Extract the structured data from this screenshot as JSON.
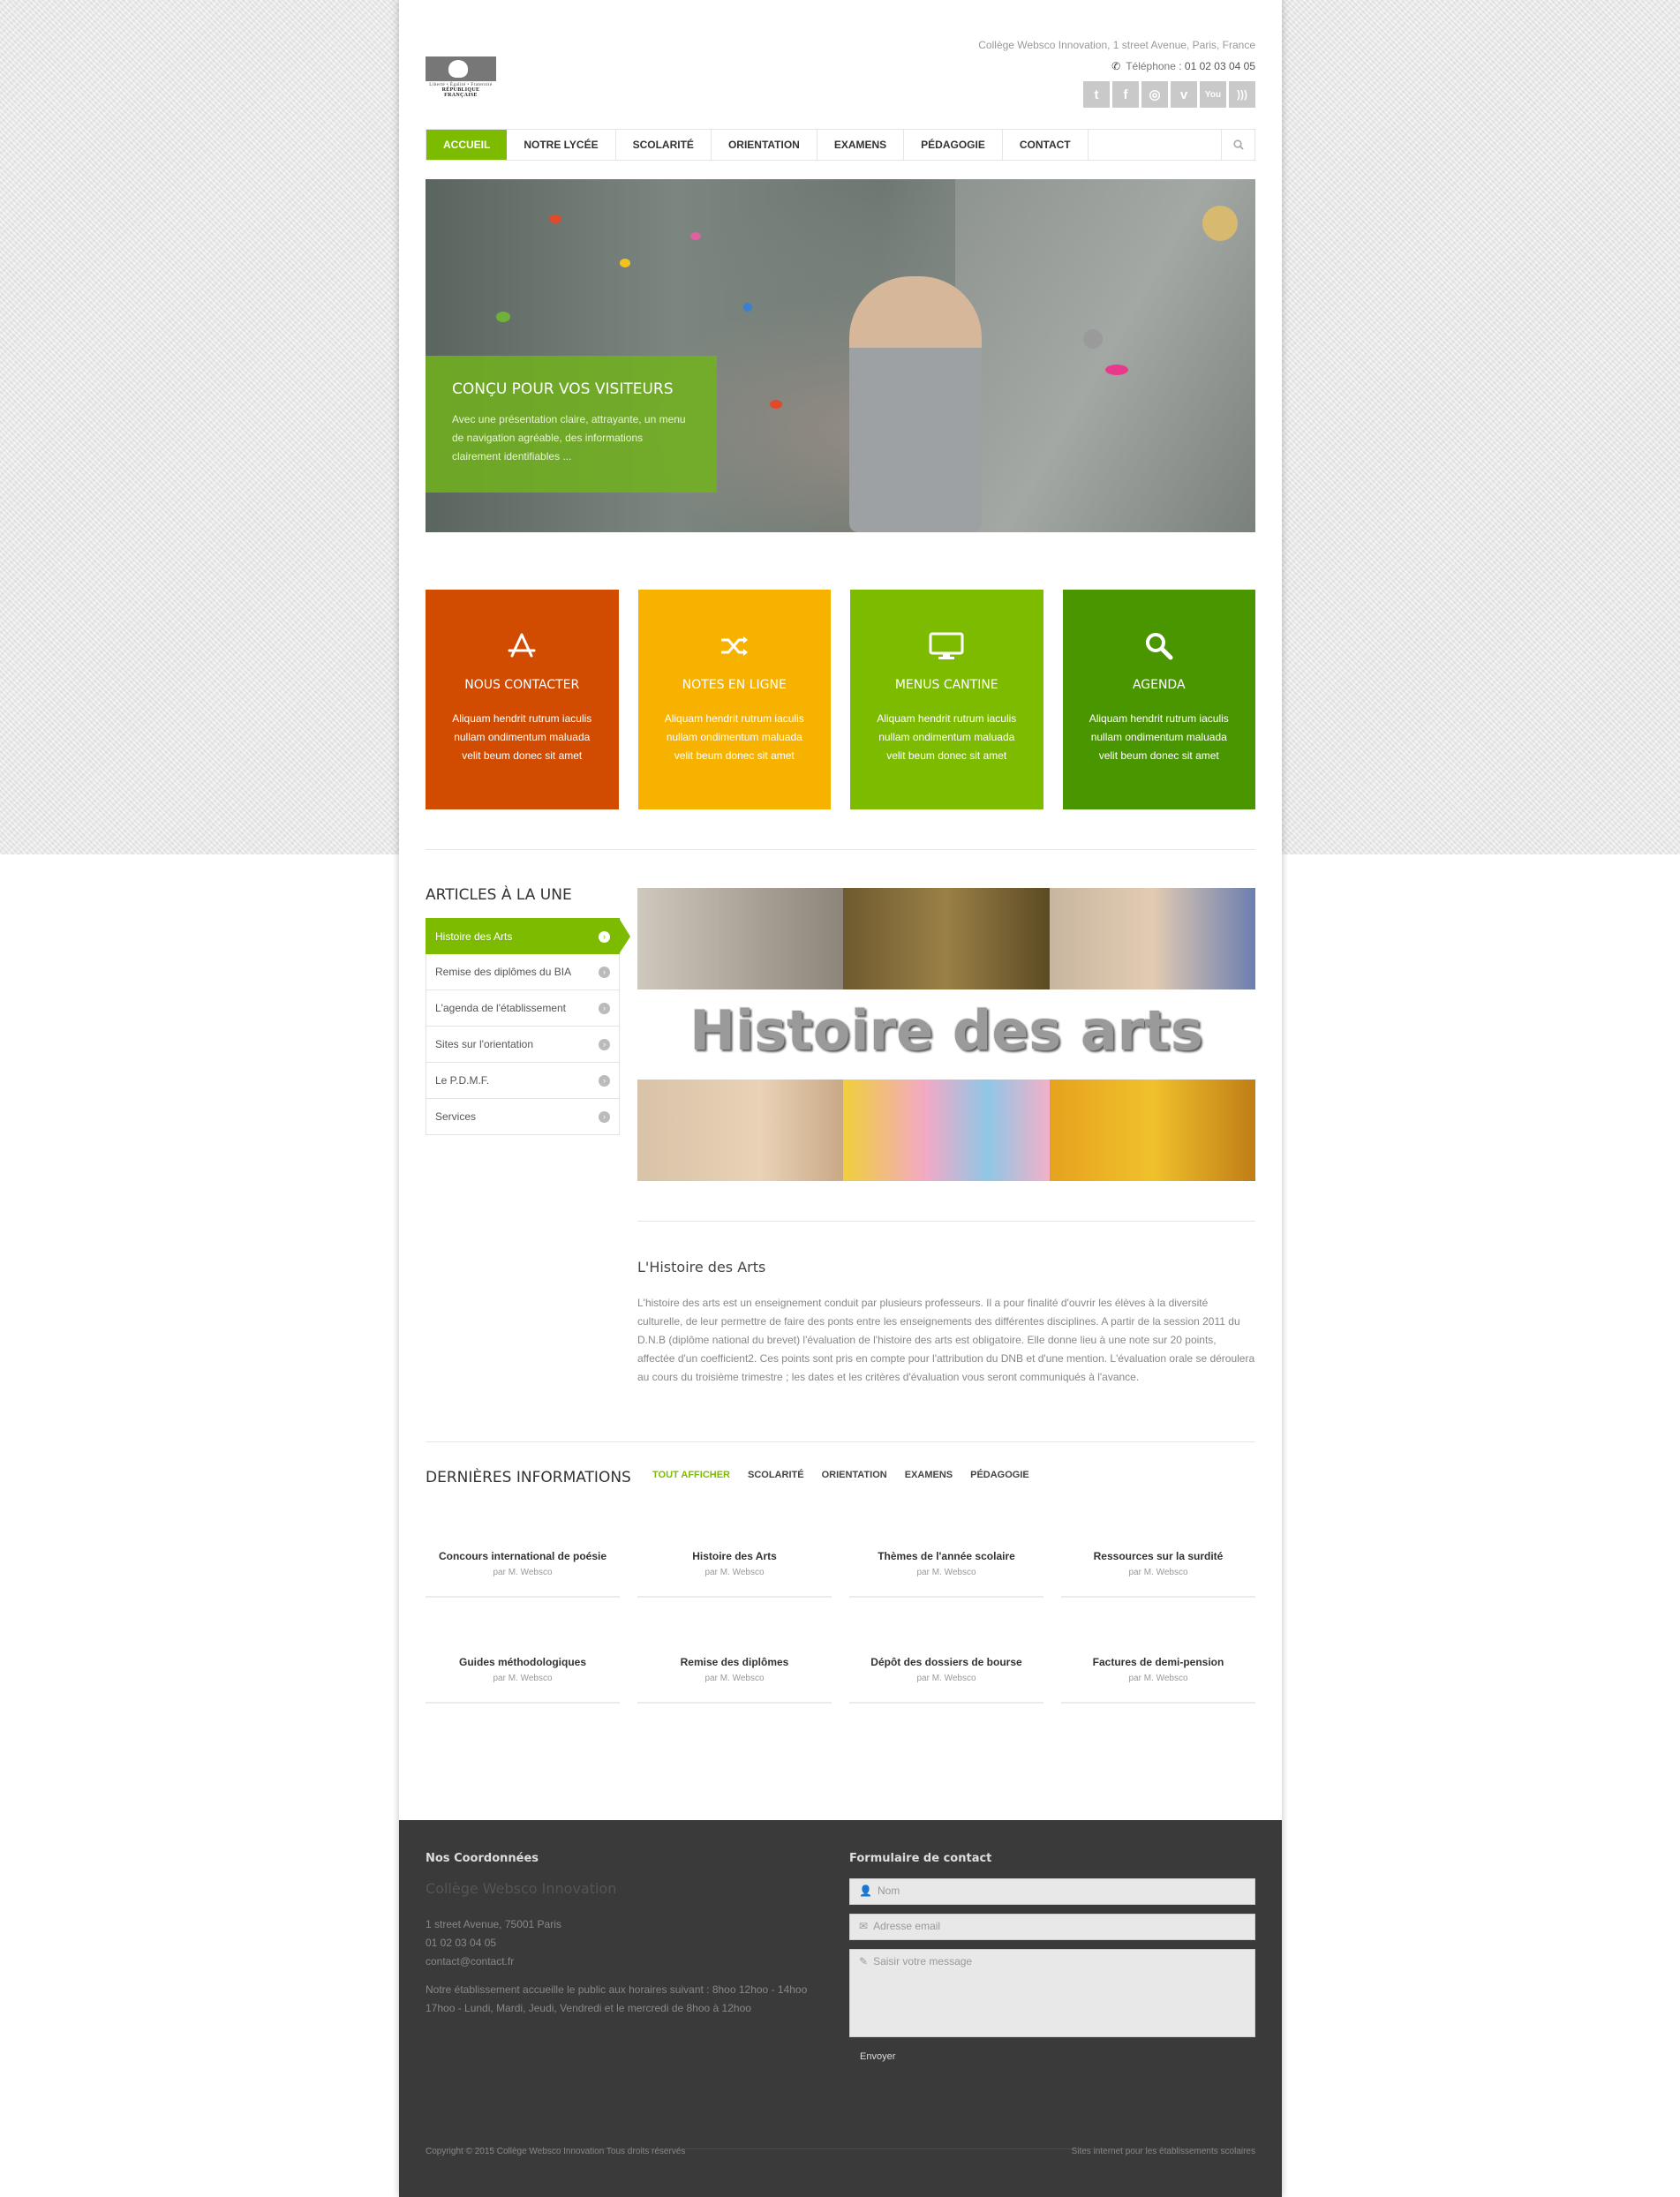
{
  "header": {
    "logo_motto": "Liberté • Égalité • Fraternité",
    "logo_rep": "RÉPUBLIQUE FRANÇAISE",
    "address": "Collège Websco Innovation, 1 street Avenue, Paris, France",
    "phone_label": "Téléphone :",
    "phone_number": "01 02 03 04 05",
    "social": [
      "twitter-icon",
      "facebook-icon",
      "dribbble-icon",
      "vimeo-icon",
      "youtube-icon",
      "rss-icon"
    ]
  },
  "nav": {
    "items": [
      "ACCUEIL",
      "NOTRE LYCÉE",
      "SCOLARITÉ",
      "ORIENTATION",
      "EXAMENS",
      "PÉDAGOGIE",
      "CONTACT"
    ],
    "active": "ACCUEIL"
  },
  "hero": {
    "title": "CONÇU POUR VOS VISITEURS",
    "text": "Avec une présentation claire, attrayante, un menu de navigation agréable, des informations clairement identifiables ..."
  },
  "boxes": [
    {
      "title": "NOUS CONTACTER",
      "text": "Aliquam hendrit rutrum iaculis nullam ondimentum maluada velit beum donec sit amet",
      "color": "#d14b00"
    },
    {
      "title": "NOTES EN LIGNE",
      "text": "Aliquam hendrit rutrum iaculis nullam ondimentum maluada velit beum donec sit amet",
      "color": "#f7b200"
    },
    {
      "title": "MENUS CANTINE",
      "text": "Aliquam hendrit rutrum iaculis nullam ondimentum maluada velit beum donec sit amet",
      "color": "#7dbb00"
    },
    {
      "title": "AGENDA",
      "text": "Aliquam hendrit rutrum iaculis nullam ondimentum maluada velit beum donec sit amet",
      "color": "#4a9600"
    }
  ],
  "articles": {
    "title": "ARTICLES À LA UNE",
    "tabs": [
      "Histoire des Arts",
      "Remise des diplômes du BIA",
      "L'agenda de l'établissement",
      "Sites sur l'orientation",
      "Le P.D.M.F.",
      "Services"
    ],
    "banner_title": "Histoire des arts",
    "article_title": "L'Histoire des Arts",
    "article_text": "L'histoire des arts est un enseignement conduit par plusieurs professeurs. Il a pour finalité d'ouvrir les élèves à la diversité culturelle, de leur permettre de faire des ponts entre les enseignements des différentes disciplines. A partir de la session 2011 du D.N.B (diplôme national du brevet) l'évaluation de l'histoire des arts est obligatoire. Elle donne lieu à une note sur 20 points, affectée d'un coefficient2. Ces points sont pris en compte pour l'attribution du DNB et d'une mention. L'évaluation orale se déroulera au cours du troisième trimestre ; les dates et les critères d'évaluation vous seront communiqués à l'avance."
  },
  "latest": {
    "title": "DERNIÈRES INFORMATIONS",
    "filters": [
      "TOUT AFFICHER",
      "SCOLARITÉ",
      "ORIENTATION",
      "EXAMENS",
      "PÉDAGOGIE"
    ],
    "cards": [
      {
        "title": "Concours international de poésie",
        "author": "par M. Websco"
      },
      {
        "title": "Histoire des Arts",
        "author": "par M. Websco"
      },
      {
        "title": "Thèmes de l'année scolaire",
        "author": "par M. Websco"
      },
      {
        "title": "Ressources sur la surdité",
        "author": "par M. Websco"
      },
      {
        "title": "Guides méthodologiques",
        "author": "par M. Websco"
      },
      {
        "title": "Remise des diplômes",
        "author": "par M. Websco"
      },
      {
        "title": "Dépôt des dossiers de bourse",
        "author": "par M. Websco"
      },
      {
        "title": "Factures de demi-pension",
        "author": "par M. Websco"
      }
    ]
  },
  "footer": {
    "coords_title": "Nos Coordonnées",
    "school": "Collège Websco Innovation",
    "address": "1 street Avenue, 75001 Paris",
    "phone": "01 02 03 04 05",
    "email": "contact@contact.fr",
    "hours": "Notre établissement accueille le public aux horaires suivant : 8hoo 12hoo - 14hoo 17hoo - Lundi, Mardi, Jeudi, Vendredi et le mercredi de 8hoo à 12hoo",
    "form_title": "Formulaire de contact",
    "name_placeholder": "Nom",
    "email_placeholder": "Adresse email",
    "message_placeholder": "Saisir votre message",
    "send": "Envoyer",
    "copyright": "Copyright © 2015 Collège Websco Innovation Tous droits réservés",
    "sites": "Sites internet pour les établissements scolaires"
  }
}
